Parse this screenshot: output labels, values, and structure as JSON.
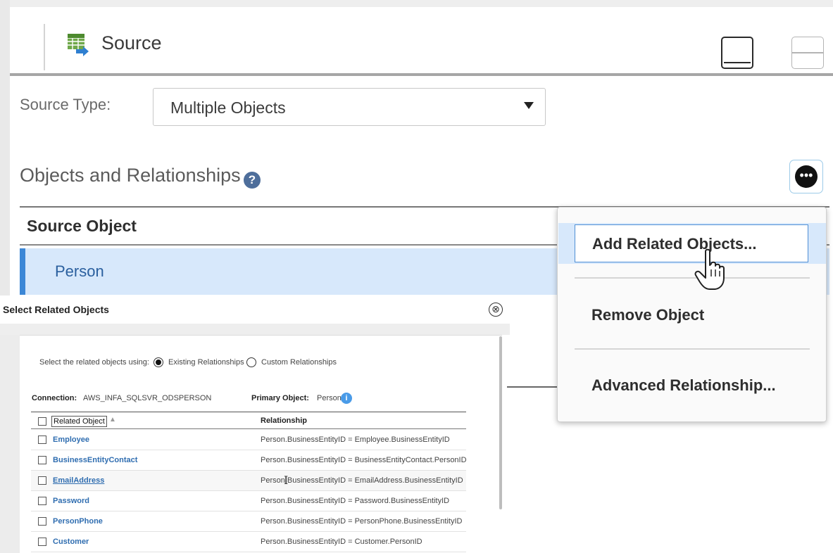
{
  "header": {
    "title": "Source",
    "icon": "source-table-icon",
    "view_buttons": [
      "single-panel-view-icon",
      "split-panel-view-icon"
    ]
  },
  "source_type": {
    "label": "Source Type:",
    "selected": "Multiple Objects"
  },
  "objects_section": {
    "title": "Objects and Relationships",
    "help_icon": "?",
    "more_icon": "•••",
    "column_header": "Source Object",
    "selected_object": "Person"
  },
  "context_menu": {
    "items": [
      {
        "label": "Add Related Objects..."
      },
      {
        "label": "Remove Object"
      },
      {
        "label": "Advanced Relationship..."
      }
    ]
  },
  "dialog": {
    "title": "Select Related Objects",
    "close_icon": "⊗",
    "select_using_label": "Select the related objects using:",
    "radio_options": [
      {
        "label": "Existing Relationships",
        "selected": true
      },
      {
        "label": "Custom Relationships",
        "selected": false
      }
    ],
    "connection_label": "Connection:",
    "connection_value": "AWS_INFA_SQLSVR_ODSPERSON",
    "primary_object_label": "Primary Object:",
    "primary_object_value": "Person",
    "info_icon": "i",
    "grid": {
      "columns": [
        "Related Object",
        "Relationship"
      ],
      "sort_indicator": "▲",
      "rows": [
        {
          "object": "Employee",
          "relationship": "Person.BusinessEntityID = Employee.BusinessEntityID"
        },
        {
          "object": "BusinessEntityContact",
          "relationship": "Person.BusinessEntityID = BusinessEntityContact.PersonID"
        },
        {
          "object": "EmailAddress",
          "relationship": "Person.BusinessEntityID = EmailAddress.BusinessEntityID"
        },
        {
          "object": "Password",
          "relationship": "Person.BusinessEntityID = Password.BusinessEntityID"
        },
        {
          "object": "PersonPhone",
          "relationship": "Person.BusinessEntityID = PersonPhone.BusinessEntityID"
        },
        {
          "object": "Customer",
          "relationship": "Person.BusinessEntityID = Customer.PersonID"
        }
      ]
    }
  },
  "colors": {
    "accent_blue": "#3c87d6",
    "selected_row": "#d7e8fb",
    "link_blue": "#2f6db0"
  }
}
